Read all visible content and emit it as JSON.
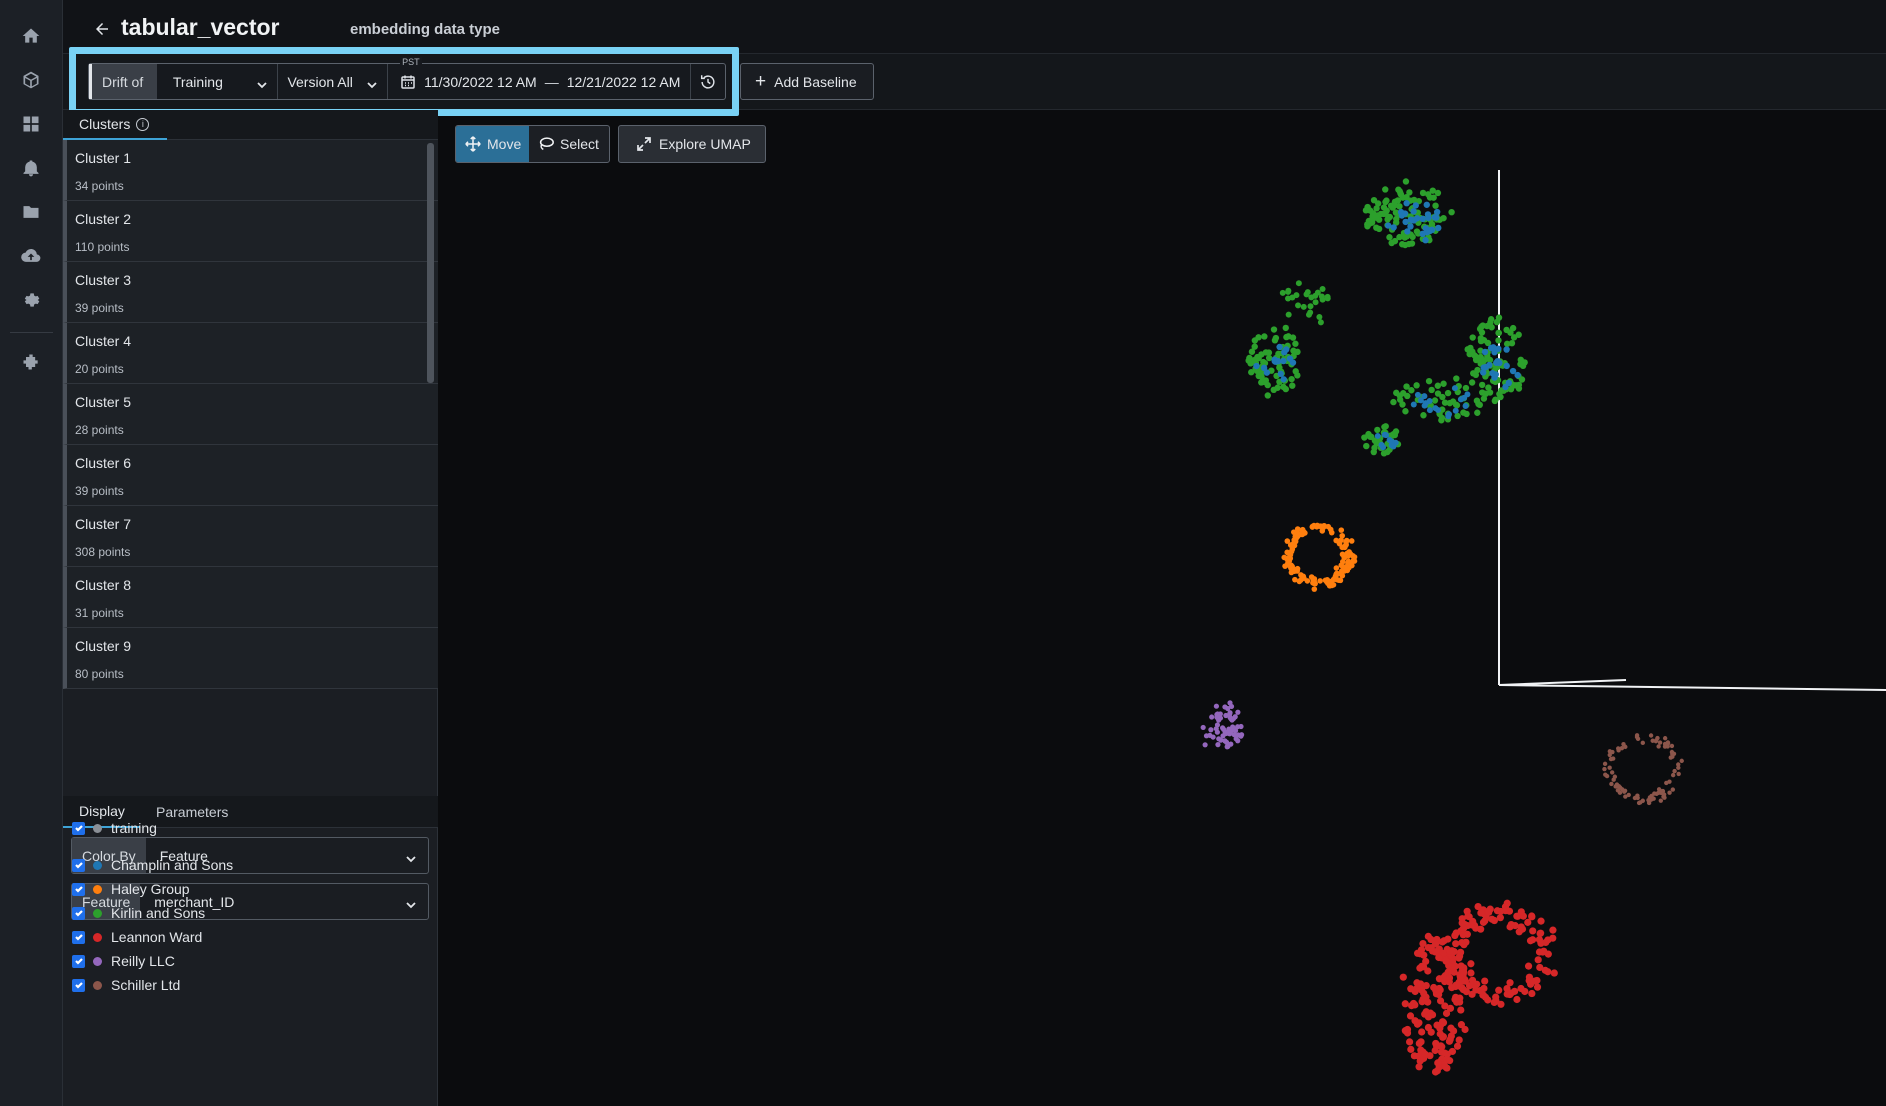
{
  "header": {
    "title": "tabular_vector",
    "subtitle": "embedding data type"
  },
  "toolbar": {
    "drift_label": "Drift of",
    "dataset_value": "Training",
    "version_value": "Version All",
    "timezone_label": "PST",
    "date_start": "11/30/2022 12 AM",
    "date_separator": "—",
    "date_end": "12/21/2022 12 AM",
    "add_baseline_label": "Add Baseline"
  },
  "panel": {
    "clusters_tab_label": "Clusters",
    "clusters": [
      {
        "name": "Cluster 1",
        "points": "34 points"
      },
      {
        "name": "Cluster 2",
        "points": "110 points"
      },
      {
        "name": "Cluster 3",
        "points": "39 points"
      },
      {
        "name": "Cluster 4",
        "points": "20 points"
      },
      {
        "name": "Cluster 5",
        "points": "28 points"
      },
      {
        "name": "Cluster 6",
        "points": "39 points"
      },
      {
        "name": "Cluster 7",
        "points": "308 points"
      },
      {
        "name": "Cluster 8",
        "points": "31 points"
      },
      {
        "name": "Cluster 9",
        "points": "80 points"
      }
    ],
    "tabs": {
      "display": "Display",
      "parameters": "Parameters"
    },
    "color_by": {
      "label": "Color By",
      "value": "Feature"
    },
    "feature": {
      "label": "Feature",
      "value": "merchant_ID"
    },
    "legend": [
      {
        "label": "training",
        "color": "#8a8f96"
      },
      {
        "label": "Champlin and Sons",
        "color": "#1f77b4"
      },
      {
        "label": "Haley Group",
        "color": "#ff7f0e"
      },
      {
        "label": "Kirlin and Sons",
        "color": "#2ca02c"
      },
      {
        "label": "Leannon Ward",
        "color": "#d62728"
      },
      {
        "label": "Reilly LLC",
        "color": "#9467bd"
      },
      {
        "label": "Schiller Ltd",
        "color": "#8c564b"
      }
    ]
  },
  "canvas": {
    "move_label": "Move",
    "select_label": "Select",
    "explore_label": "Explore UMAP"
  },
  "icons": [
    "home-icon",
    "cube-icon",
    "dashboard-icon",
    "bell-icon",
    "folder-icon",
    "cloud-upload-icon",
    "settings-icon",
    "integrations-icon"
  ],
  "colors": {
    "accent": "#3ea3d6",
    "highlight": "#79d2f5",
    "move_active": "#2b6f97"
  }
}
